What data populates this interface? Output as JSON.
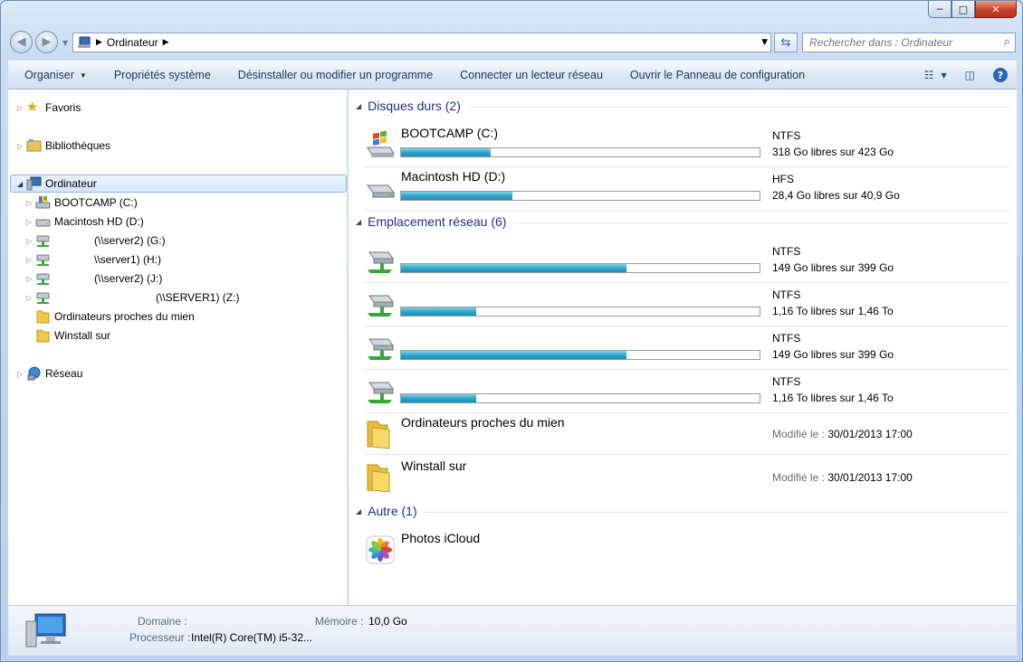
{
  "window": {
    "minimize": "─",
    "maximize": "□",
    "close": "✕"
  },
  "address": {
    "crumb": "Ordinateur"
  },
  "search": {
    "placeholder": "Rechercher dans : Ordinateur"
  },
  "toolbar": {
    "organise": "Organiser",
    "system_props": "Propriétés système",
    "uninstall": "Désinstaller ou modifier un programme",
    "map_drive": "Connecter un lecteur réseau",
    "control_panel": "Ouvrir le Panneau de configuration"
  },
  "nav": {
    "favorites": "Favoris",
    "libraries": "Bibliothèques",
    "computer": "Ordinateur",
    "items": [
      {
        "label": "BOOTCAMP (C:)"
      },
      {
        "label": "Macintosh HD (D:)"
      },
      {
        "label": "(\\\\server2) (G:)"
      },
      {
        "label": "\\\\server1) (H:)"
      },
      {
        "label": "(\\\\server2) (J:)"
      },
      {
        "label": "(\\\\SERVER1) (Z:)"
      },
      {
        "label": "Ordinateurs proches du mien"
      },
      {
        "label": "Winstall sur"
      }
    ],
    "network": "Réseau"
  },
  "groups": {
    "hard_drives": "Disques durs (2)",
    "network": "Emplacement réseau (6)",
    "other": "Autre (1)"
  },
  "drives": [
    {
      "name": "BOOTCAMP (C:)",
      "fs": "NTFS",
      "free": "318 Go libres sur 423 Go",
      "used_fraction": 0.25
    },
    {
      "name": "Macintosh HD (D:)",
      "fs": "HFS",
      "free": "28,4 Go libres sur 40,9 Go",
      "used_fraction": 0.31
    }
  ],
  "network_drives": [
    {
      "fs": "NTFS",
      "free": "149 Go libres sur 399 Go",
      "used_fraction": 0.63
    },
    {
      "fs": "NTFS",
      "free": "1,16 To libres sur 1,46 To",
      "used_fraction": 0.21
    },
    {
      "fs": "NTFS",
      "free": "149 Go libres sur 399 Go",
      "used_fraction": 0.63
    },
    {
      "fs": "NTFS",
      "free": "1,16 To libres sur 1,46 To",
      "used_fraction": 0.21
    }
  ],
  "folders": [
    {
      "name": "Ordinateurs proches du mien",
      "modified_label": "Modifié le :",
      "modified": "30/01/2013 17:00"
    },
    {
      "name": "Winstall sur",
      "modified_label": "Modifié le :",
      "modified": "30/01/2013 17:00"
    }
  ],
  "other": {
    "name": "Photos iCloud"
  },
  "details": {
    "domain_label": "Domaine :",
    "memory_label": "Mémoire :",
    "memory": "10,0 Go",
    "cpu_label": "Processeur :",
    "cpu": "Intel(R) Core(TM) i5-32..."
  },
  "colors": {
    "accent": "#1e3287",
    "bar": "#2aa2c9"
  }
}
